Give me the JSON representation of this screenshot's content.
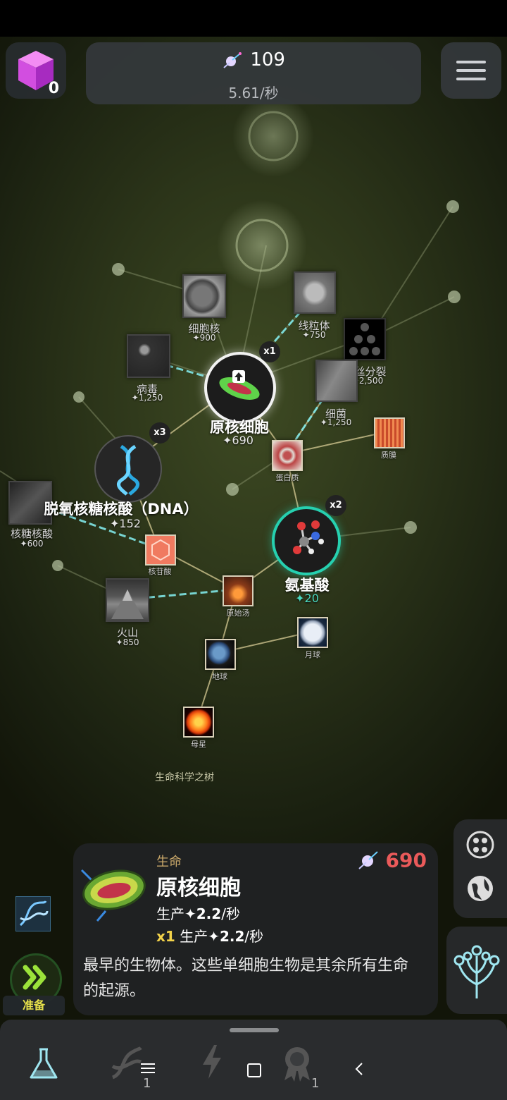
{
  "hud": {
    "cube_count": "0",
    "currency_amount": "109",
    "currency_rate": "5.61/秒"
  },
  "tree": {
    "title": "生命科学之树",
    "nodes": {
      "cell_nucleus": {
        "name": "细胞核",
        "cost": "900"
      },
      "mitochondria": {
        "name": "线粒体",
        "cost": "750"
      },
      "mitosis": {
        "name": "丝分裂",
        "cost": "2,500"
      },
      "virus": {
        "name": "病毒",
        "cost": "1,250"
      },
      "bacteria": {
        "name": "细菌",
        "cost": "1,250"
      },
      "prokaryote": {
        "name": "原核细胞",
        "cost": "690",
        "mult": "x1"
      },
      "membrane": {
        "name": "质膜"
      },
      "protein": {
        "name": "蛋白质"
      },
      "dna": {
        "name": "脱氧核糖核酸（DNA）",
        "cost": "152",
        "mult": "x3"
      },
      "rna": {
        "name": "核糖核酸",
        "cost": "600"
      },
      "nucleotide": {
        "name": "核苷酸"
      },
      "amino_acid": {
        "name": "氨基酸",
        "cost": "20",
        "mult": "x2"
      },
      "primordial_soup": {
        "name": "原始汤"
      },
      "volcano": {
        "name": "火山",
        "cost": "850"
      },
      "moon": {
        "name": "月球"
      },
      "earth": {
        "name": "地球"
      },
      "parent_star": {
        "name": "母星"
      }
    }
  },
  "info": {
    "category": "生命",
    "price": "690",
    "name": "原核细胞",
    "prod_label": "生产",
    "prod_value": "2.2",
    "prod_unit": "/秒",
    "mult": "x1",
    "prod2_label": "生产",
    "prod2_value": "2.2",
    "prod2_unit": "/秒",
    "description": "最早的生物体。这些单细胞生物是其余所有生命的起源。"
  },
  "left": {
    "ready_label": "准备"
  },
  "nav": {
    "dna_badge": "1",
    "award_badge": "1"
  },
  "colors": {
    "accent_red": "#ea5a5a",
    "accent_yellow": "#f3d34a",
    "link_cyan": "#7fe6e6",
    "amino_ring": "#26d0b0"
  },
  "icons": [
    "purple-cube-icon",
    "spark-currency-icon",
    "hamburger-menu-icon",
    "fast-forward-icon",
    "molecules-icon",
    "globe-icon",
    "tree-branch-icon",
    "flask-icon",
    "dna-icon",
    "lightning-icon",
    "award-icon",
    "home-square-icon",
    "back-icon",
    "recent-apps-icon"
  ]
}
